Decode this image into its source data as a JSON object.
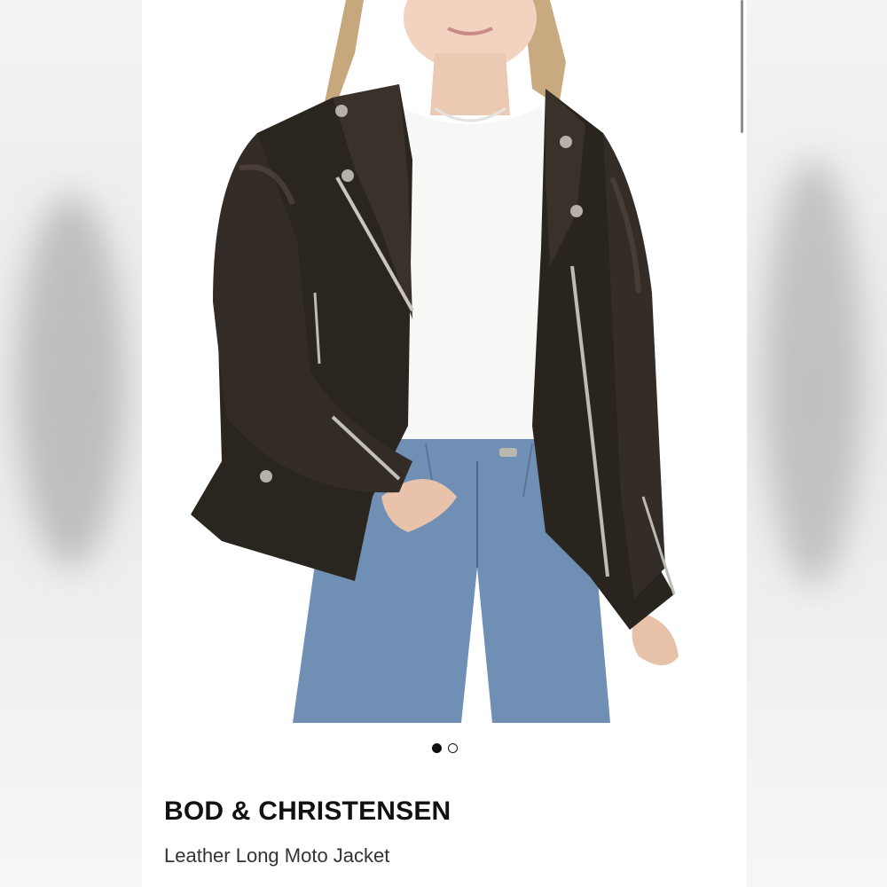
{
  "carousel": {
    "total_slides": 2,
    "active_slide": 1
  },
  "product": {
    "brand": "BOD & CHRISTENSEN",
    "name": "Leather Long Moto Jacket",
    "image_icon": "product-photo-icon"
  },
  "colors": {
    "background": "#ffffff",
    "text_primary": "#111111",
    "text_secondary": "#333333",
    "jacket": "#2b2520",
    "jeans": "#6f8fb4",
    "tshirt": "#f7f7f5"
  }
}
